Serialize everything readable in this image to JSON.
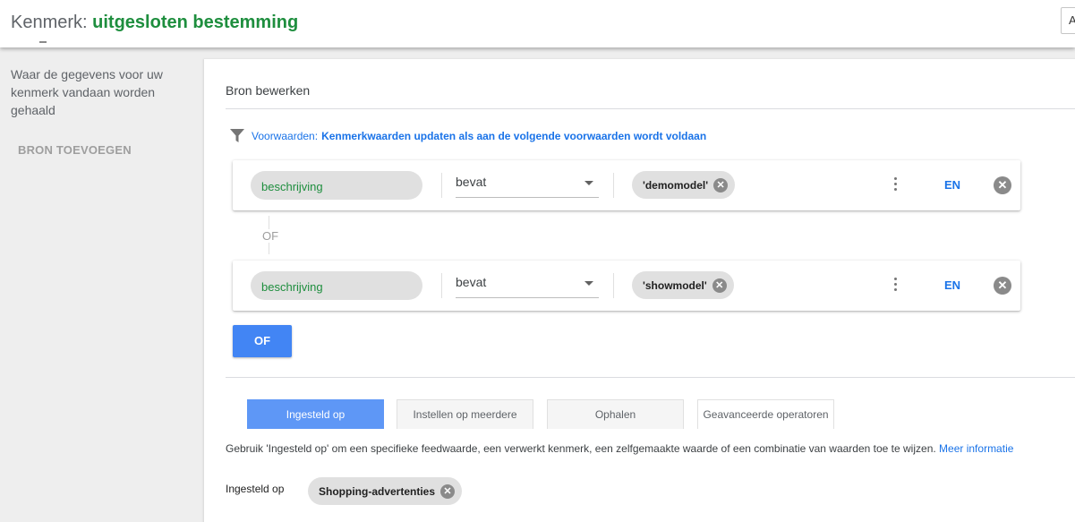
{
  "header": {
    "prefix": "Kenmerk:",
    "name": "uitgesloten bestemming",
    "edge_button": "A"
  },
  "sidebar": {
    "description": "Waar de gegevens voor uw kenmerk vandaan worden gehaald",
    "add_source": "BRON TOEVOEGEN"
  },
  "main": {
    "source_title": "Bron bewerken",
    "conditions_label": "Voorwaarden:",
    "conditions_text": "Kenmerkwaarden updaten als aan de volgende voorwaarden wordt voldaan",
    "filter_icon": "filter-icon",
    "conditions": [
      {
        "field": "beschrijving",
        "operator": "bevat",
        "value": "'demomodel'",
        "and_label": "EN"
      },
      {
        "field": "beschrijving",
        "operator": "bevat",
        "value": "'showmodel'",
        "and_label": "EN"
      }
    ],
    "or_separator": "OF",
    "or_button": "OF",
    "tabs": [
      {
        "label": "Ingesteld op",
        "active": true
      },
      {
        "label": "Instellen op meerdere",
        "active": false
      },
      {
        "label": "Ophalen",
        "active": false
      },
      {
        "label": "Geavanceerde operatoren",
        "active": false
      }
    ],
    "help_text": "Gebruik 'Ingesteld op' om een specifieke feedwaarde, een verwerkt kenmerk, een zelfgemaakte waarde of een combinatie van waarden toe te wijzen.",
    "help_link": "Meer informatie",
    "set_label": "Ingesteld op",
    "set_value": "Shopping-advertenties"
  },
  "colors": {
    "accent_blue": "#1a73e8",
    "button_blue": "#4285f4",
    "green": "#1e8e3e"
  }
}
